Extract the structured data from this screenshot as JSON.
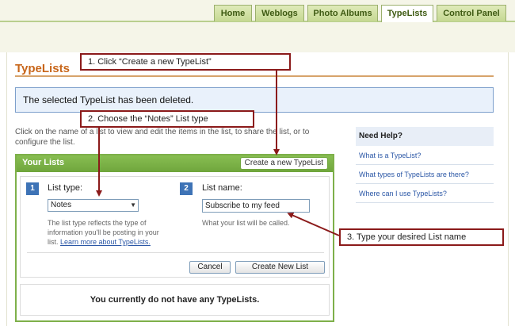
{
  "nav": {
    "tabs": [
      {
        "label": "Home"
      },
      {
        "label": "Weblogs"
      },
      {
        "label": "Photo Albums"
      },
      {
        "label": "TypeLists"
      },
      {
        "label": "Control Panel"
      }
    ],
    "active_tab": "TypeLists"
  },
  "page": {
    "title": "TypeLists",
    "message": "The selected TypeList has been deleted.",
    "intro": "Click on the name of a list to view and edit the items in the list, to share the list, or to configure the list."
  },
  "your_lists": {
    "title": "Your Lists",
    "create_label": "Create a new TypeList",
    "step1_num": "1",
    "list_type_label": "List type:",
    "list_type_value": "Notes",
    "list_type_help": "The list type reflects the type of information you'll be posting in your list.",
    "learn_more": "Learn more about TypeLists.",
    "step2_num": "2",
    "list_name_label": "List name:",
    "list_name_value": "Subscribe to my feed",
    "list_name_help": "What your list will be called.",
    "cancel_label": "Cancel",
    "create_button_label": "Create New List",
    "empty_text": "You currently do not have any TypeLists."
  },
  "help": {
    "title": "Need Help?",
    "items": [
      "What is a TypeList?",
      "What types of TypeLists are there?",
      "Where can I use TypeLists?"
    ]
  },
  "callouts": {
    "step1": "1. Click “Create a new TypeList”",
    "step2": "2. Choose the “Notes” List type",
    "step3": "3. Type your desired List name"
  },
  "colors": {
    "accent_green": "#7eb04a",
    "title_orange": "#c8661a",
    "callout_red": "#8b1a1a",
    "link_blue": "#2b57a6"
  }
}
